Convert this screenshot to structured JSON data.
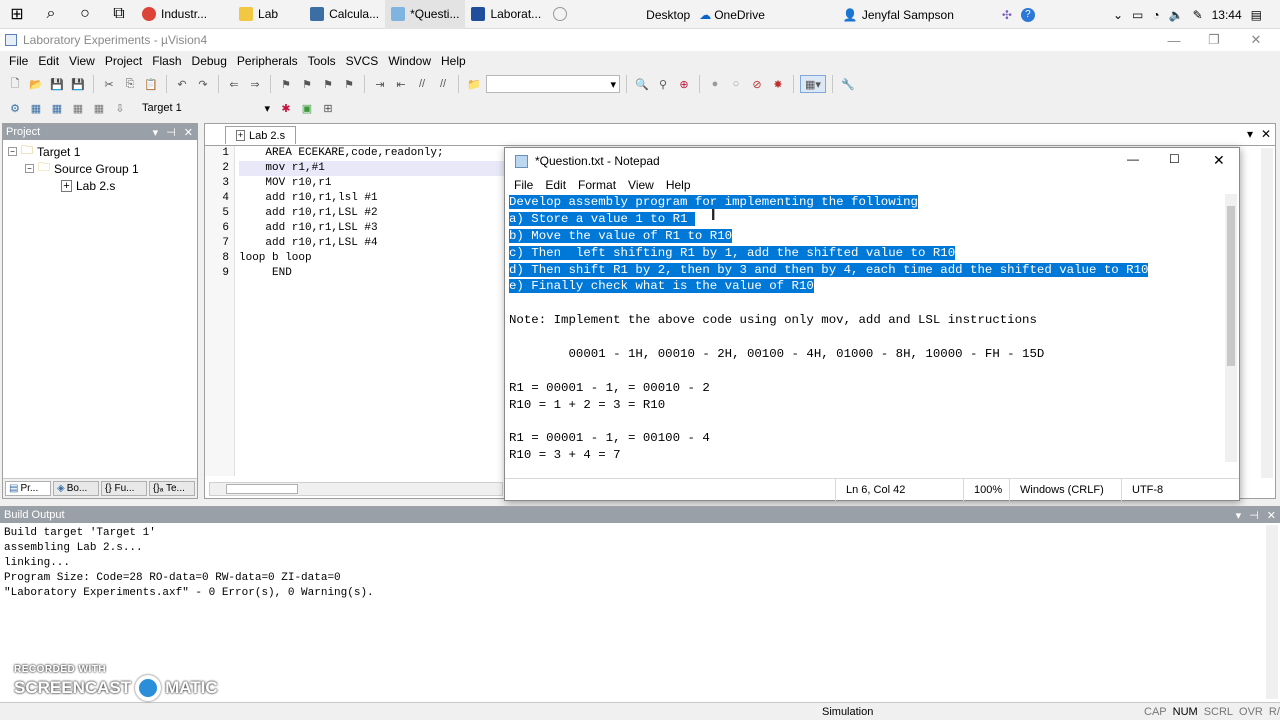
{
  "taskbar": {
    "apps": [
      {
        "label": "Industr..."
      },
      {
        "label": "Lab"
      },
      {
        "label": "Calcula..."
      },
      {
        "label": "*Questi..."
      },
      {
        "label": "Laborat..."
      }
    ],
    "desktop": "Desktop",
    "onedrive": "OneDrive",
    "user": "Jenyfal Sampson",
    "time": "13:44"
  },
  "window": {
    "title": "Laboratory Experiments - µVision4"
  },
  "menu": [
    "File",
    "Edit",
    "View",
    "Project",
    "Flash",
    "Debug",
    "Peripherals",
    "Tools",
    "SVCS",
    "Window",
    "Help"
  ],
  "toolbar2": {
    "target": "Target 1"
  },
  "project": {
    "header": "Project",
    "tree": [
      {
        "label": "Target 1"
      },
      {
        "label": "Source Group 1"
      },
      {
        "label": "Lab 2.s"
      }
    ],
    "tabs": [
      "Pr...",
      "Bo...",
      "{} Fu...",
      "{}ₐ Te..."
    ]
  },
  "editor": {
    "tab": "Lab 2.s",
    "lines": [
      "    AREA ECEKARE,code,readonly;",
      "    mov r1,#1",
      "    MOV r10,r1",
      "    add r10,r1,lsl #1",
      "    add r10,r1,LSL #2",
      "    add r10,r1,LSL #3",
      "    add r10,r1,LSL #4",
      "loop b loop",
      "     END"
    ],
    "line_numbers": [
      "1",
      "2",
      "3",
      "4",
      "5",
      "6",
      "7",
      "8",
      "9"
    ]
  },
  "notepad": {
    "title": "*Question.txt - Notepad",
    "menu": [
      "File",
      "Edit",
      "Format",
      "View",
      "Help"
    ],
    "selected_lines": [
      "Develop assembly program for implementing the following",
      "a) Store a value 1 to R1 ",
      "b) Move the value of R1 to R10",
      "c) Then  left shifting R1 by 1, add the shifted value to R10",
      "d) Then shift R1 by 2, then by 3 and then by 4, each time add the shifted value to R10",
      "e) Finally check what is the value of R10"
    ],
    "lines": [
      "",
      "Note: Implement the above code using only mov, add and LSL instructions",
      "",
      "        00001 - 1H, 00010 - 2H, 00100 - 4H, 01000 - 8H, 10000 - FH - 15D",
      "",
      "R1 = 00001 - 1, = 00010 - 2",
      "R10 = 1 + 2 = 3 = R10",
      "",
      "R1 = 00001 - 1, = 00100 - 4",
      "R10 = 3 + 4 = 7"
    ],
    "status": {
      "position": "Ln 6, Col 42",
      "zoom": "100%",
      "line_ending": "Windows (CRLF)",
      "encoding": "UTF-8"
    }
  },
  "build": {
    "header": "Build Output",
    "lines": [
      "Build target 'Target 1'",
      "assembling Lab 2.s...",
      "linking...",
      "Program Size: Code=28 RO-data=0 RW-data=0 ZI-data=0",
      "\"Laboratory Experiments.axf\" - 0 Error(s), 0 Warning(s)."
    ]
  },
  "statusbar": {
    "mode": "Simulation",
    "indicators": [
      "CAP",
      "NUM",
      "SCRL",
      "OVR",
      "R/W"
    ]
  },
  "watermark": {
    "line1": "RECORDED WITH",
    "line2": "SCREENCAST",
    "line3": "MATIC"
  }
}
